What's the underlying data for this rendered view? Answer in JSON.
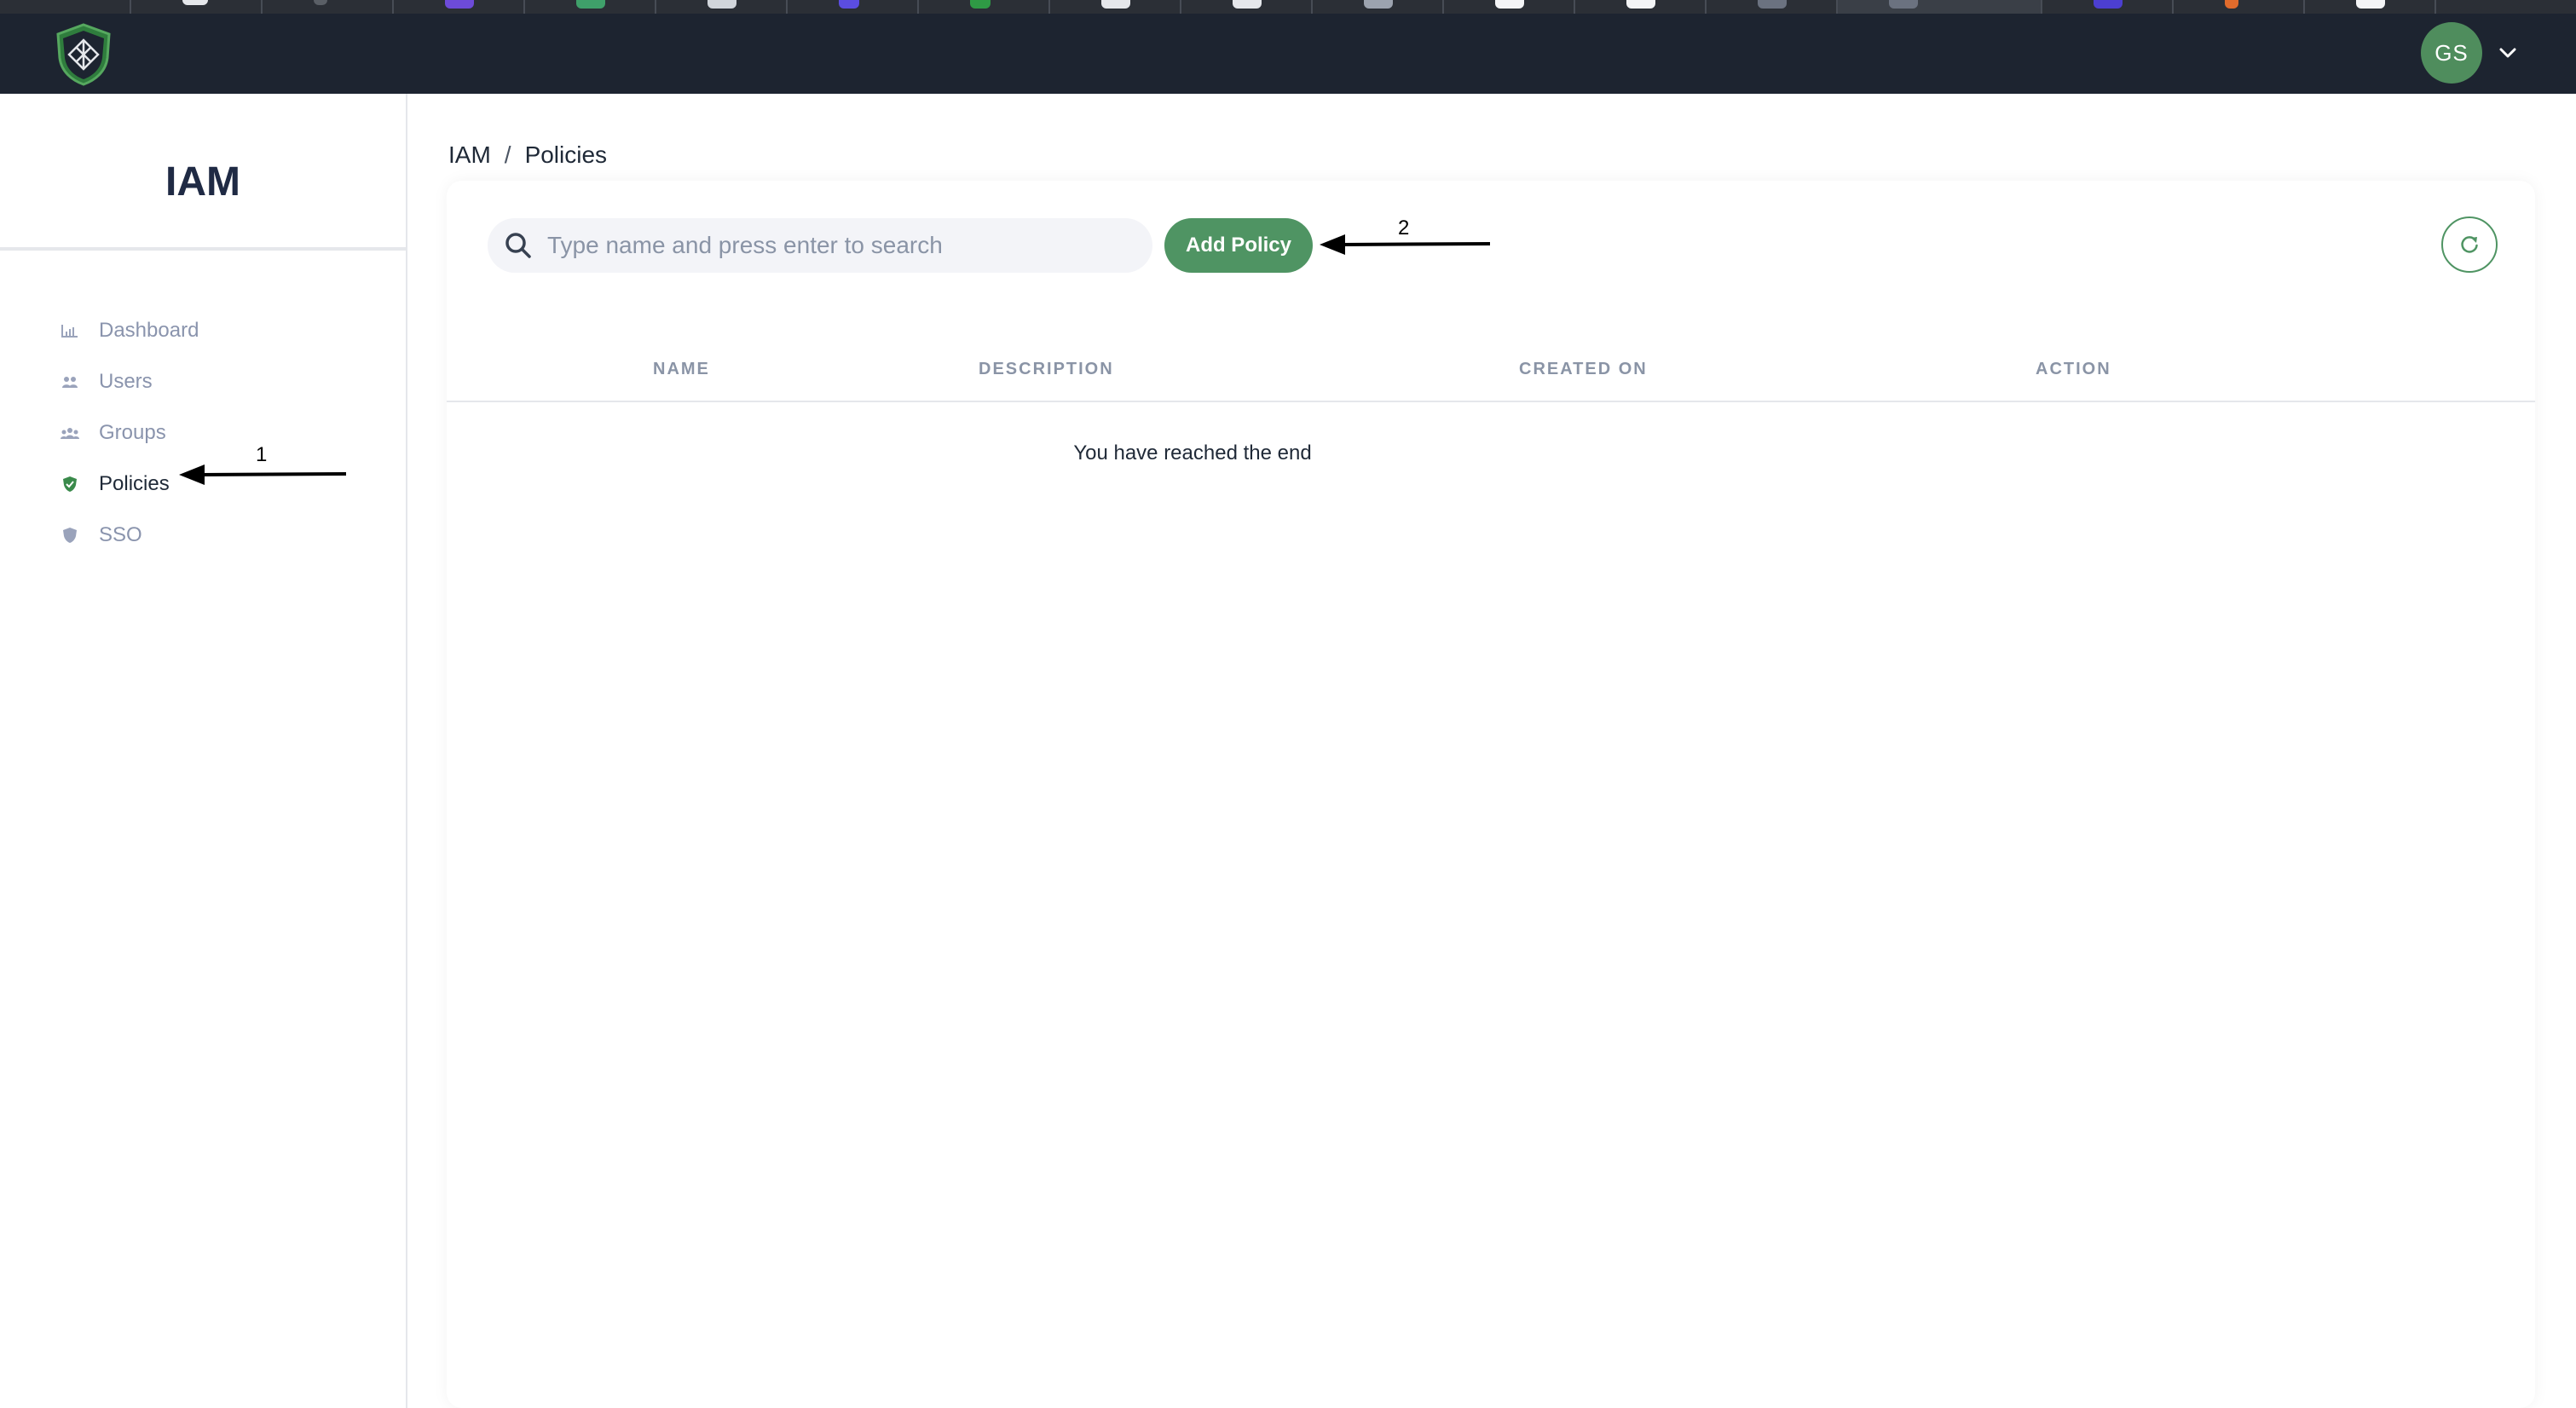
{
  "app": {
    "title": "IAM",
    "brand_color": "#4f9463",
    "topbar_color": "#1d2430"
  },
  "user": {
    "initials": "GS"
  },
  "sidebar": {
    "title": "IAM",
    "items": [
      {
        "label": "Dashboard",
        "icon": "bar-chart-icon",
        "active": false
      },
      {
        "label": "Users",
        "icon": "users-icon",
        "active": false
      },
      {
        "label": "Groups",
        "icon": "groups-icon",
        "active": false
      },
      {
        "label": "Policies",
        "icon": "shield-check-icon",
        "active": true
      },
      {
        "label": "SSO",
        "icon": "shield-icon",
        "active": false
      }
    ]
  },
  "breadcrumb": {
    "root": "IAM",
    "separator": "/",
    "current": "Policies"
  },
  "toolbar": {
    "search_placeholder": "Type name and press enter to search",
    "search_value": "",
    "add_label": "Add Policy"
  },
  "table": {
    "columns": [
      "NAME",
      "DESCRIPTION",
      "CREATED ON",
      "ACTION"
    ],
    "rows": [],
    "end_message": "You have reached the end"
  },
  "annotations": {
    "one": "1",
    "two": "2"
  }
}
